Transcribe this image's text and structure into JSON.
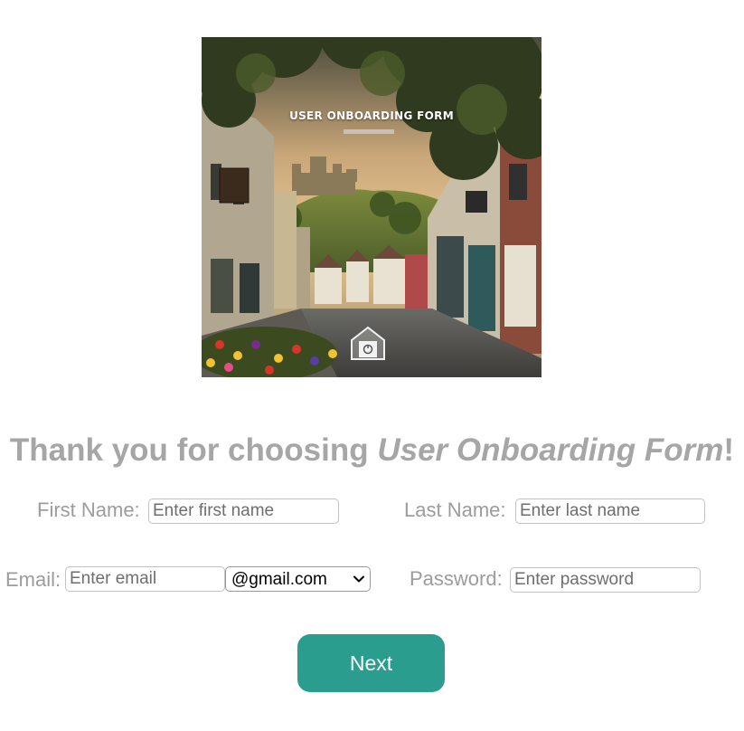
{
  "hero": {
    "title": "USER ONBOARDING FORM"
  },
  "heading": {
    "prefix": "Thank you for choosing ",
    "app_name": "User Onboarding Form",
    "suffix": "!"
  },
  "form": {
    "first_name": {
      "label": "First Name:",
      "placeholder": "Enter first name",
      "value": ""
    },
    "last_name": {
      "label": "Last Name:",
      "placeholder": "Enter last name",
      "value": ""
    },
    "email": {
      "label": "Email:",
      "placeholder": "Enter email",
      "value": "",
      "domain_selected": "@gmail.com"
    },
    "password": {
      "label": "Password:",
      "placeholder": "Enter password",
      "value": ""
    },
    "next_label": "Next"
  },
  "colors": {
    "accent": "#2a9d8f",
    "label_gray": "#9c9c9c",
    "heading_gray": "#a6a6a6"
  },
  "icons": {
    "hero_badge": "house-badge-icon",
    "select_arrow": "chevron-down-icon"
  }
}
